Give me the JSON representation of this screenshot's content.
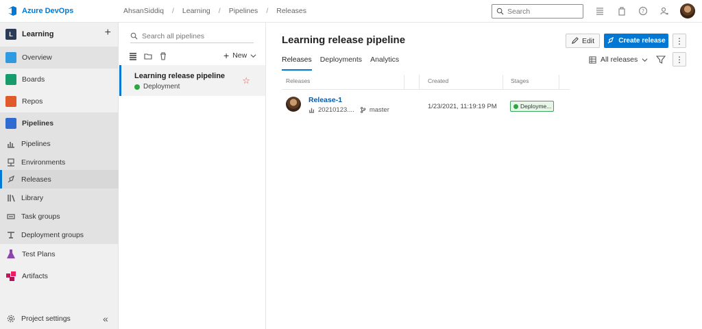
{
  "header": {
    "brand": "Azure DevOps",
    "breadcrumbs": [
      "AhsanSiddiq",
      "Learning",
      "Pipelines",
      "Releases"
    ],
    "search_placeholder": "Search"
  },
  "sidebar": {
    "project_initial": "L",
    "project_name": "Learning",
    "items": [
      {
        "label": "Overview",
        "icon": "overview-icon",
        "color": "#2f9adf"
      },
      {
        "label": "Boards",
        "icon": "boards-icon",
        "color": "#159c6a"
      },
      {
        "label": "Repos",
        "icon": "repos-icon",
        "color": "#e05a2b"
      },
      {
        "label": "Pipelines",
        "icon": "pipelines-icon",
        "color": "#2f6bd1"
      },
      {
        "label": "Pipelines",
        "icon": "pipelines-sub-icon",
        "color": "#555555"
      },
      {
        "label": "Environments",
        "icon": "environments-icon",
        "color": "#555555"
      },
      {
        "label": "Releases",
        "icon": "releases-icon",
        "color": "#555555"
      },
      {
        "label": "Library",
        "icon": "library-icon",
        "color": "#555555"
      },
      {
        "label": "Task groups",
        "icon": "task-groups-icon",
        "color": "#555555"
      },
      {
        "label": "Deployment groups",
        "icon": "deployment-groups-icon",
        "color": "#555555"
      },
      {
        "label": "Test Plans",
        "icon": "test-plans-icon",
        "color": "#8e44ad"
      },
      {
        "label": "Artifacts",
        "icon": "artifacts-icon",
        "color": "#c2185b"
      }
    ],
    "settings_label": "Project settings"
  },
  "pipelines_panel": {
    "search_placeholder": "Search all pipelines",
    "new_label": "New",
    "selected_pipeline": {
      "name": "Learning release pipeline",
      "status": "Deployment"
    }
  },
  "main": {
    "title": "Learning release pipeline",
    "edit_label": "Edit",
    "create_label": "Create release",
    "tabs": [
      "Releases",
      "Deployments",
      "Analytics"
    ],
    "view_filter": "All releases",
    "columns": [
      "Releases",
      "Created",
      "Stages"
    ],
    "rows": [
      {
        "name": "Release-1",
        "build": "20210123....",
        "branch": "master",
        "created": "1/23/2021, 11:19:19 PM",
        "stage": "Deployme..."
      }
    ]
  }
}
